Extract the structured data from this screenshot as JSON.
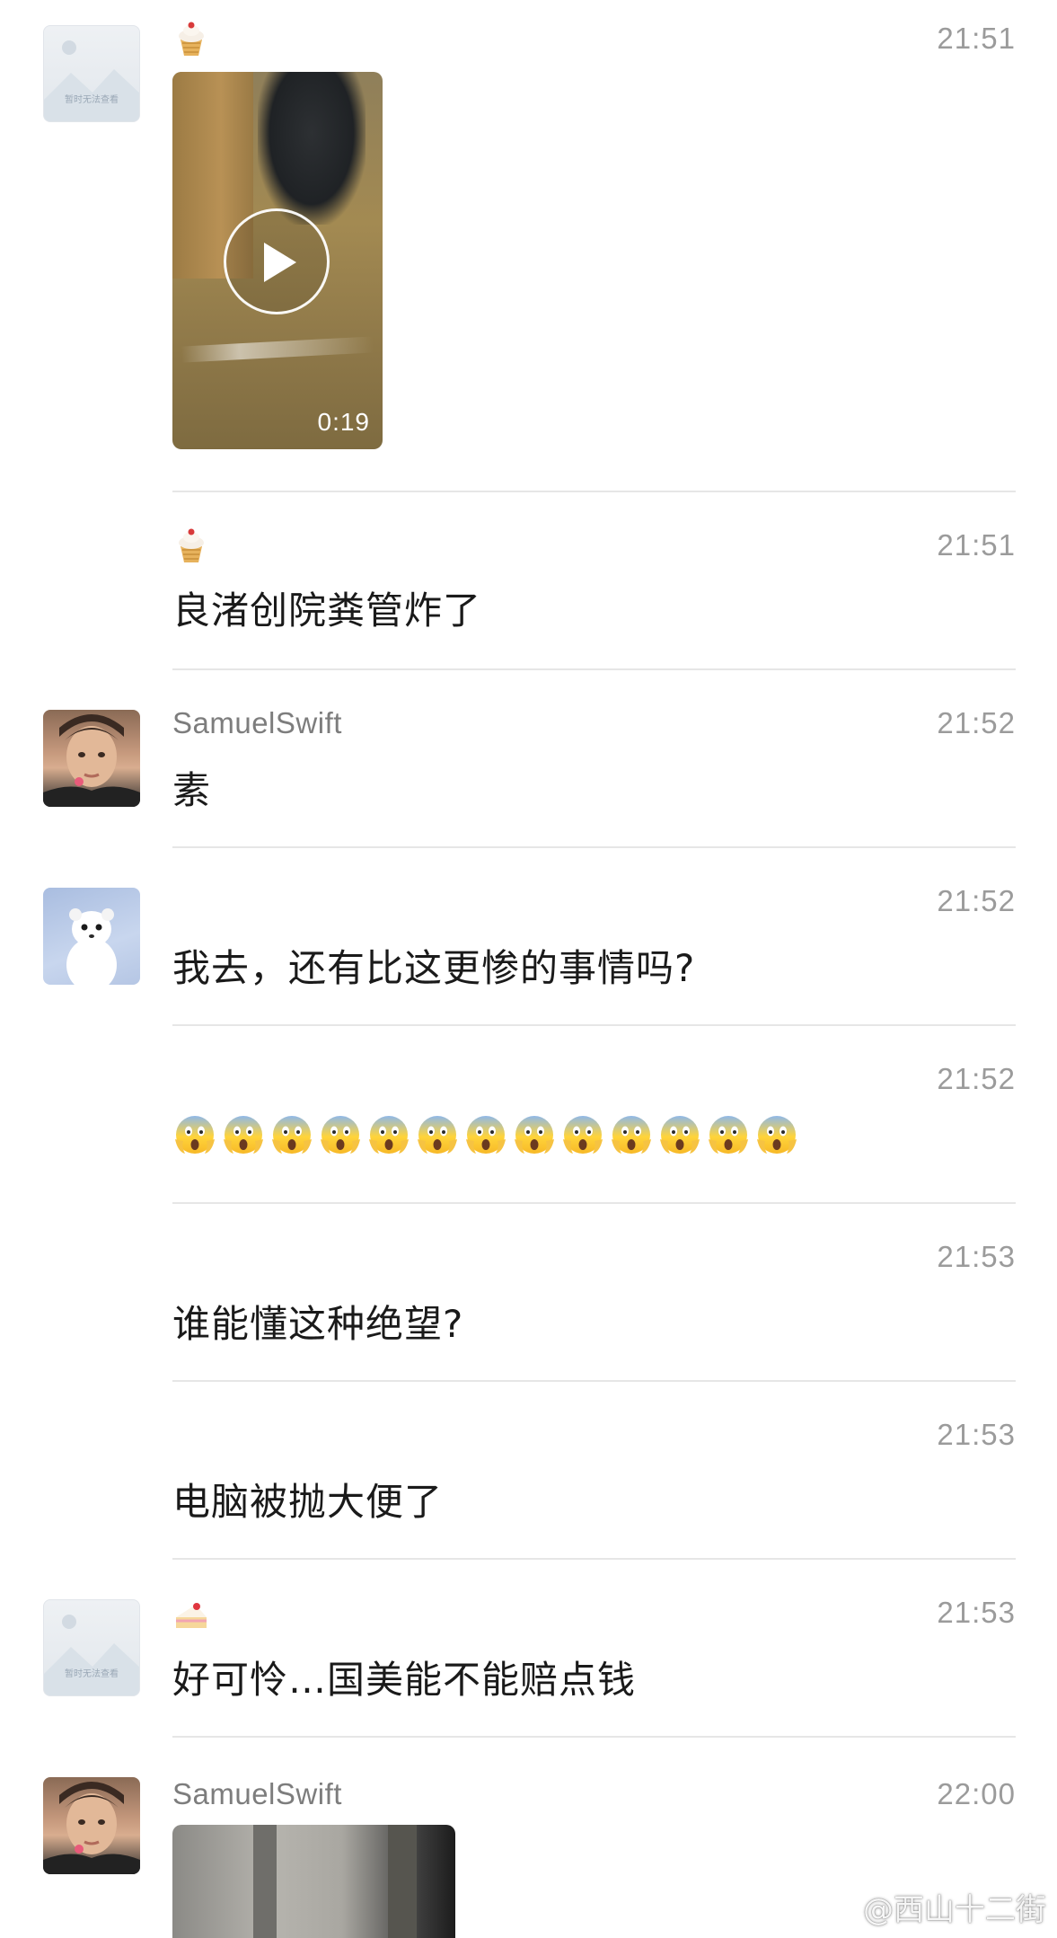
{
  "messages": [
    {
      "avatar": "image-unavailable",
      "badge": "cupcake-emoji",
      "time": "21:51",
      "video_duration": "0:19"
    },
    {
      "badge": "cupcake-emoji",
      "time": "21:51",
      "text": "良渚创院粪管炸了"
    },
    {
      "avatar": "man-portrait",
      "name": "SamuelSwift",
      "time": "21:52",
      "text": "素"
    },
    {
      "avatar": "white-ferret",
      "time": "21:52",
      "text": "我去，还有比这更惨的事情吗?"
    },
    {
      "time": "21:52",
      "emoji_name": "face-screaming-in-fear-emoji",
      "emoji_count": 13
    },
    {
      "time": "21:53",
      "text": "谁能懂这种绝望?"
    },
    {
      "time": "21:53",
      "text": "电脑被抛大便了"
    },
    {
      "avatar": "image-unavailable",
      "badge": "shortcake-emoji",
      "time": "21:53",
      "text": "好可怜…国美能不能赔点钱"
    },
    {
      "avatar": "man-portrait",
      "name": "SamuelSwift",
      "time": "22:00"
    }
  ],
  "placeholder_caption": "暂时无法查看",
  "watermark": "@西山十二街",
  "colors": {
    "time": "#9b9b9b",
    "name": "#7d7d7d",
    "divider": "#e6e6e6"
  }
}
